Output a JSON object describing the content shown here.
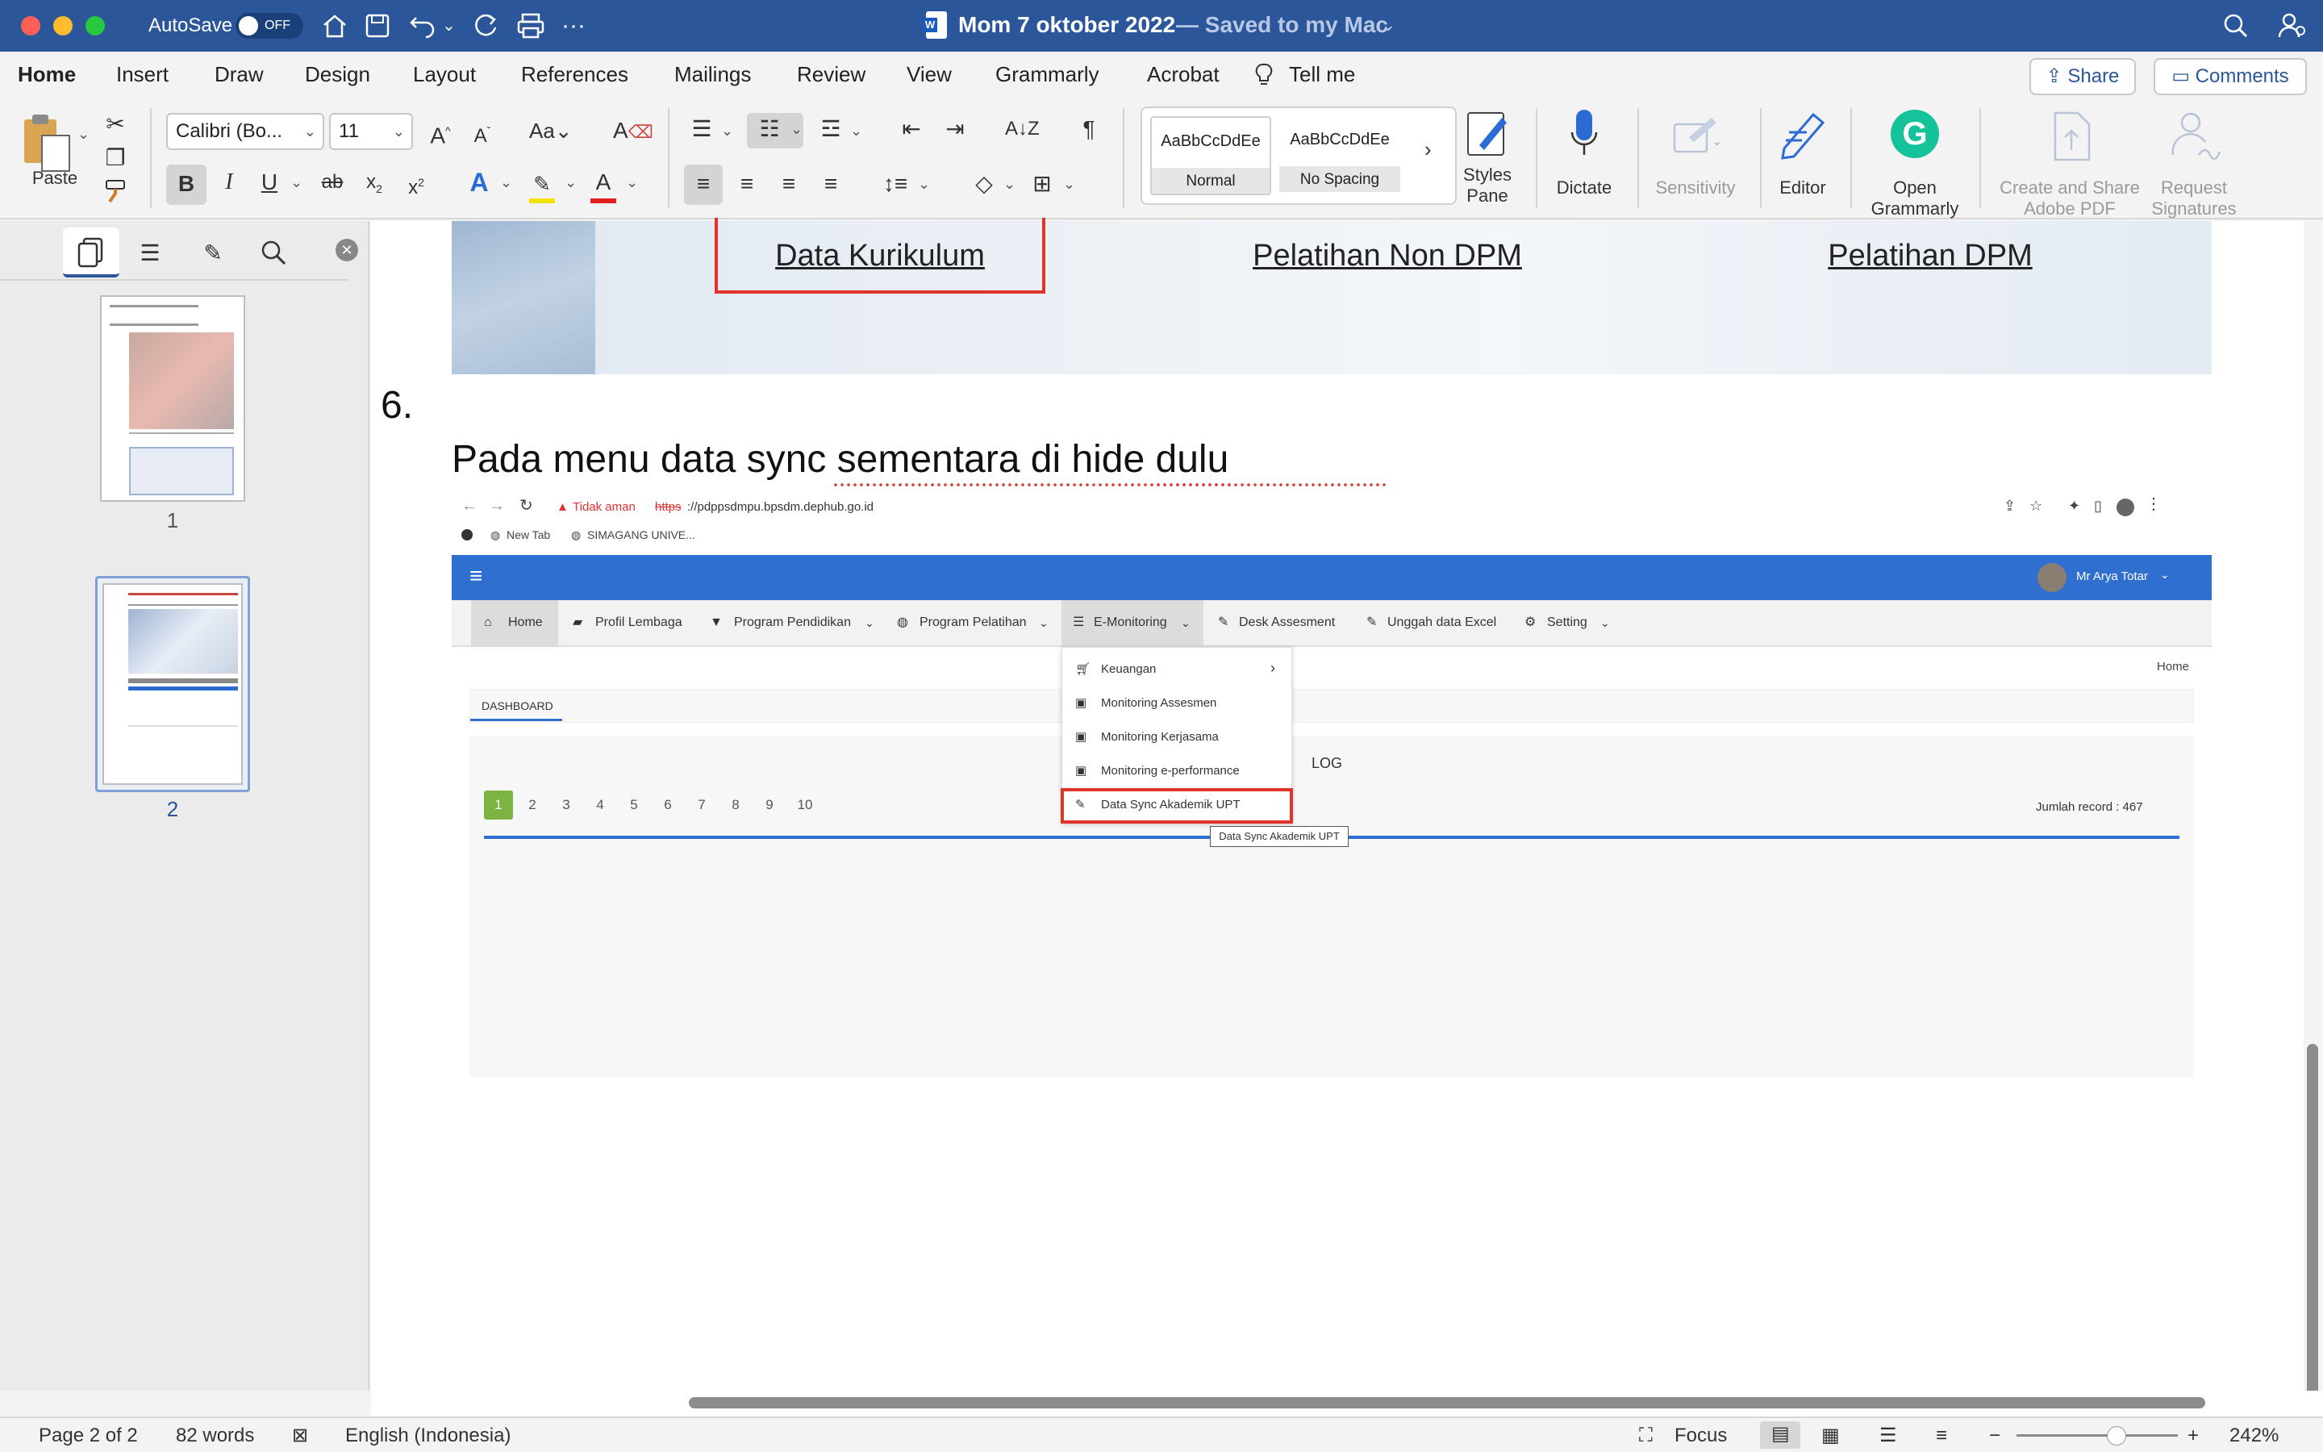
{
  "titlebar": {
    "autosave_label": "AutoSave",
    "autosave_state": "OFF",
    "doc_title": "Mom 7 oktober 2022",
    "saved_status": "— Saved to my Mac",
    "colors": {
      "bar": "#2b579a",
      "close": "#ff5f57",
      "minimize": "#febc2e",
      "zoom": "#28c840"
    }
  },
  "tabs": [
    "Home",
    "Insert",
    "Draw",
    "Design",
    "Layout",
    "References",
    "Mailings",
    "Review",
    "View",
    "Grammarly",
    "Acrobat",
    "Tell me"
  ],
  "share_label": "Share",
  "comments_label": "Comments",
  "ribbon": {
    "paste": "Paste",
    "font_name": "Calibri (Bo...",
    "font_size": "11",
    "styles": [
      {
        "preview": "AaBbCcDdEe",
        "name": "Normal"
      },
      {
        "preview": "AaBbCcDdEe",
        "name": "No Spacing"
      }
    ],
    "styles_pane": [
      "Styles",
      "Pane"
    ],
    "dictate": "Dictate",
    "sensitivity": "Sensitivity",
    "editor": "Editor",
    "open_grammarly": [
      "Open",
      "Grammarly"
    ],
    "create_share_pdf": [
      "Create and Share",
      "Adobe PDF"
    ],
    "request_signatures": [
      "Request",
      "Signatures"
    ]
  },
  "nav": {
    "pages": [
      "1",
      "2"
    ],
    "current_page": "2"
  },
  "doc": {
    "banner_links": [
      "Data Kurikulum",
      "Pelatihan Non DPM",
      "Pelatihan DPM"
    ],
    "step_number": "6.",
    "step_text": "Pada menu data sync sementara di hide dulu",
    "shot": {
      "security": "Tidak aman",
      "url_scheme": "https",
      "url_rest": "://pdppsdmpu.bpsdm.dephub.go.id",
      "bookmarks": [
        "New Tab",
        "SIMAGANG UNIVE..."
      ],
      "user": "Mr Arya Totar",
      "menu": [
        "Home",
        "Profil Lembaga",
        "Program Pendidikan",
        "Program Pelatihan",
        "E-Monitoring",
        "Desk Assesment",
        "Unggah data Excel",
        "Setting"
      ],
      "dropdown": [
        "Keuangan",
        "Monitoring Assesmen",
        "Monitoring Kerjasama",
        "Monitoring e-performance",
        "Data Sync Akademik UPT"
      ],
      "tooltip": "Data Sync Akademik UPT",
      "breadcrumb": "Home",
      "dashboard_tab": "DASHBOARD",
      "log_title": "LOG",
      "pages": [
        "1",
        "2",
        "3",
        "4",
        "5",
        "6",
        "7",
        "8",
        "9",
        "10"
      ],
      "record_count": "Jumlah record : 467"
    }
  },
  "status": {
    "page": "Page 2 of 2",
    "words": "82 words",
    "language": "English (Indonesia)",
    "focus": "Focus",
    "zoom": "242%"
  }
}
